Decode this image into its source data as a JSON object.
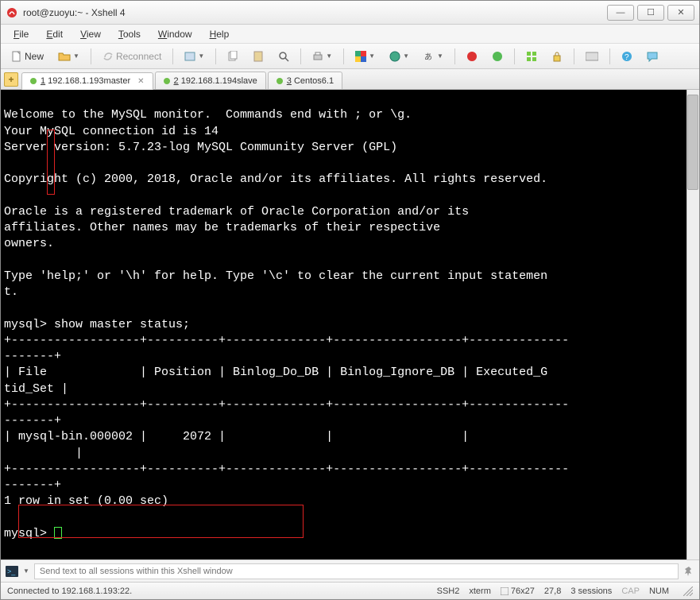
{
  "window": {
    "title": "root@zuoyu:~ - Xshell 4"
  },
  "menus": [
    "File",
    "Edit",
    "View",
    "Tools",
    "Window",
    "Help"
  ],
  "toolbar": {
    "new": "New",
    "reconnect": "Reconnect"
  },
  "tabs": [
    {
      "label": "1 192.168.1.193master",
      "active": true,
      "has_close": true
    },
    {
      "label": "2 192.168.1.194slave",
      "active": false,
      "has_close": false
    },
    {
      "label": "3 Centos6.1",
      "active": false,
      "has_close": false
    }
  ],
  "terminal_lines": [
    "Welcome to the MySQL monitor.  Commands end with ; or \\g.",
    "Your MySQL connection id is 14",
    "Server version: 5.7.23-log MySQL Community Server (GPL)",
    "",
    "Copyright (c) 2000, 2018, Oracle and/or its affiliates. All rights reserved.",
    "",
    "Oracle is a registered trademark of Oracle Corporation and/or its",
    "affiliates. Other names may be trademarks of their respective",
    "owners.",
    "",
    "Type 'help;' or '\\h' for help. Type '\\c' to clear the current input statemen",
    "t.",
    "",
    "mysql> show master status;",
    "+------------------+----------+--------------+------------------+--------------",
    "-------+",
    "| File             | Position | Binlog_Do_DB | Binlog_Ignore_DB | Executed_G",
    "tid_Set |",
    "+------------------+----------+--------------+------------------+--------------",
    "-------+",
    "| mysql-bin.000002 |     2072 |              |                  |",
    "          |",
    "+------------------+----------+--------------+------------------+--------------",
    "-------+",
    "1 row in set (0.00 sec)",
    "",
    "mysql> "
  ],
  "sendbar": {
    "placeholder": "Send text to all sessions within this Xshell window"
  },
  "status": {
    "left": "Connected to 192.168.1.193:22.",
    "proto": "SSH2",
    "term": "xterm",
    "size": "76x27",
    "pos": "27,8",
    "sessions": "3 sessions",
    "cap": "CAP",
    "num": "NUM"
  },
  "chart_data": {
    "type": "table",
    "title": "show master status",
    "columns": [
      "File",
      "Position",
      "Binlog_Do_DB",
      "Binlog_Ignore_DB",
      "Executed_Gtid_Set"
    ],
    "rows": [
      {
        "File": "mysql-bin.000002",
        "Position": 2072,
        "Binlog_Do_DB": "",
        "Binlog_Ignore_DB": "",
        "Executed_Gtid_Set": ""
      }
    ],
    "footer": "1 row in set (0.00 sec)"
  }
}
